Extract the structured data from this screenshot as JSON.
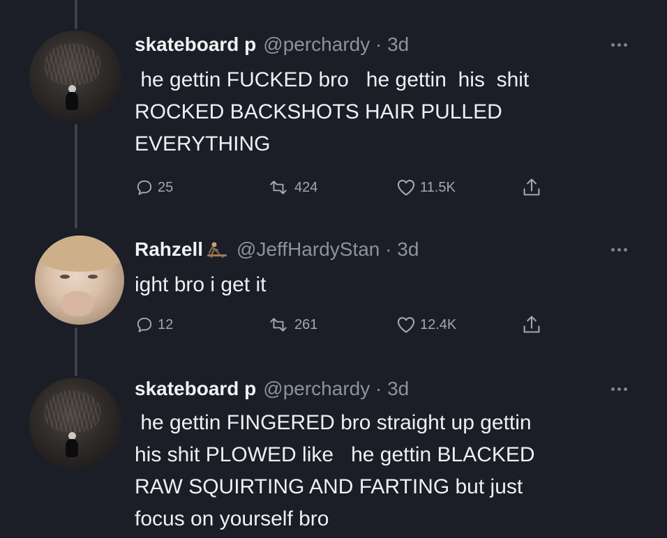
{
  "tweets": [
    {
      "name": "skateboard p",
      "handle": "@perchardy · 3d",
      "lines": [
        " he gettin FUCKED bro   he gettin  his  shit",
        "ROCKED BACKSHOTS HAIR PULLED",
        "EVERYTHING"
      ],
      "replies": "25",
      "retweets": "424",
      "likes": "11.5K",
      "avatar_icon": "dark-tree-avatar"
    },
    {
      "name": "Rahzell",
      "name_emoji": "skateboarder-emoji",
      "handle": "@JeffHardyStan · 3d",
      "lines": [
        "ight bro i get it"
      ],
      "replies": "12",
      "retweets": "261",
      "likes": "12.4K",
      "avatar_icon": "girl-face-avatar"
    },
    {
      "name": "skateboard p",
      "handle": "@perchardy · 3d",
      "lines": [
        " he gettin FINGERED bro straight up gettin",
        "his shit PLOWED like   he gettin BLACKED",
        "RAW SQUIRTING AND FARTING but just",
        "focus on yourself bro"
      ],
      "avatar_icon": "dark-tree-avatar"
    }
  ],
  "icons": {
    "reply": "reply-icon",
    "retweet": "retweet-icon",
    "like": "heart-icon",
    "share": "share-icon",
    "more": "more-dots-icon"
  },
  "colors": {
    "background": "#1b1d27",
    "text": "#eef0f1",
    "secondary": "#8b949b",
    "thread_line": "#3d414a"
  }
}
